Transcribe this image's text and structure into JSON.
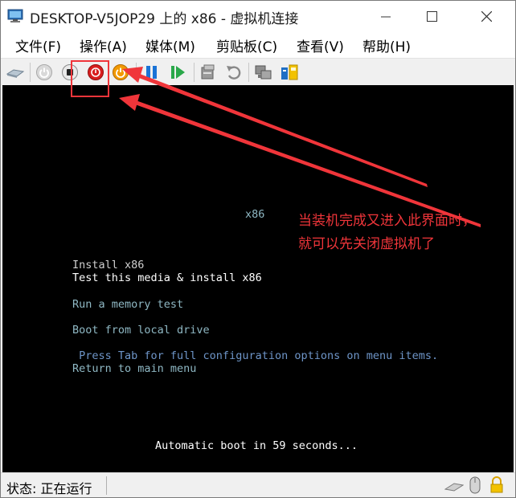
{
  "window": {
    "title": "DESKTOP-V5JOP29 上的 x86 - 虚拟机连接"
  },
  "menu": [
    "文件(F)",
    "操作(A)",
    "媒体(M)",
    "剪贴板(C)",
    "查看(V)",
    "帮助(H)"
  ],
  "toolbar": {
    "buttons": [
      "ctrl-alt-del-icon",
      "start-icon",
      "turn-off-icon",
      "shutdown-icon",
      "reset-icon",
      "pause-icon",
      "resume-icon",
      "checkpoint-icon",
      "revert-icon",
      "enhanced-session-icon",
      "share-icon"
    ],
    "colors": {
      "turn_off": "#d81e1e",
      "shutdown": "#f29a00",
      "pause": "#1a73d6",
      "resume": "#2aa84a"
    }
  },
  "vm_screen": {
    "heading": "x86",
    "menu_options": [
      "Install x86",
      "Test this media & install x86",
      "Run a memory test",
      "Boot from local drive",
      "Return to main menu"
    ],
    "hint": " Press Tab for full configuration options on menu items.",
    "countdown": "Automatic boot in 59 seconds..."
  },
  "annotation": {
    "line1": "当装机完成又进入此界面时，",
    "line2": "就可以先关闭虚拟机了",
    "color": "#f0353a"
  },
  "statusbar": {
    "status": "状态: 正在运行"
  }
}
